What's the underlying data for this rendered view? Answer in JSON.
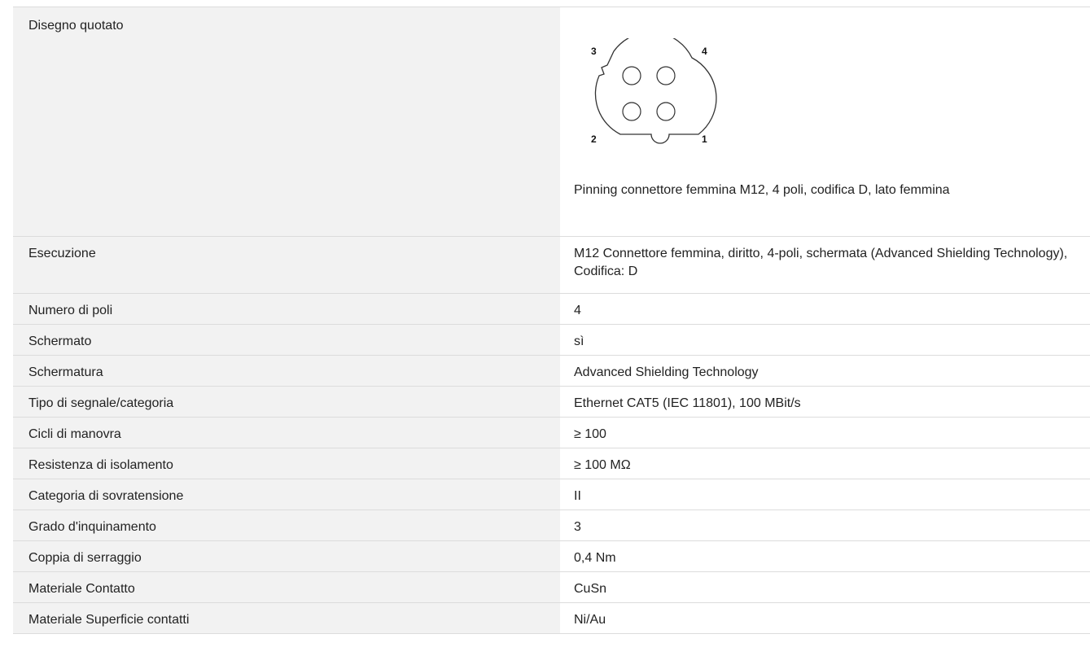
{
  "drawing": {
    "label": "Disegno quotato",
    "caption": "Pinning connettore femmina M12, 4 poli, codifica D, lato femmina",
    "pins": [
      "1",
      "2",
      "3",
      "4"
    ]
  },
  "specs": [
    {
      "label": "Esecuzione",
      "value": "M12 Connettore femmina, diritto, 4-poli, schermata (Advanced Shielding Technology), Codifica: D"
    },
    {
      "label": "Numero di poli",
      "value": "4"
    },
    {
      "label": "Schermato",
      "value": "sì"
    },
    {
      "label": "Schermatura",
      "value": "Advanced Shielding Technology"
    },
    {
      "label": "Tipo di segnale/categoria",
      "value": "Ethernet CAT5 (IEC 11801), 100 MBit/s"
    },
    {
      "label": "Cicli di manovra",
      "value": "≥ 100"
    },
    {
      "label": "Resistenza di isolamento",
      "value": "≥ 100 MΩ"
    },
    {
      "label": "Categoria di sovratensione",
      "value": "II"
    },
    {
      "label": "Grado d'inquinamento",
      "value": "3"
    },
    {
      "label": "Coppia di serraggio",
      "value": "0,4 Nm"
    },
    {
      "label": "Materiale Contatto",
      "value": "CuSn"
    },
    {
      "label": "Materiale Superficie contatti",
      "value": "Ni/Au"
    }
  ]
}
